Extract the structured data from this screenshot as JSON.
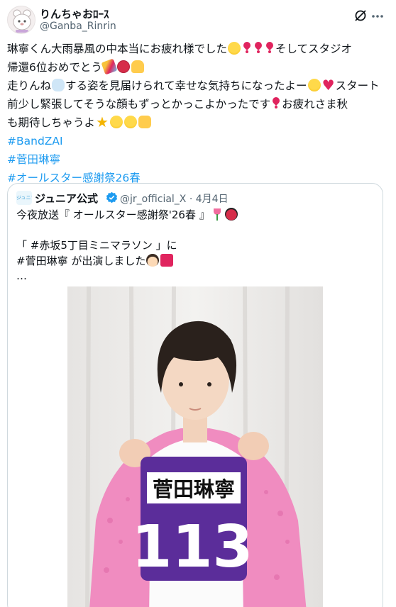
{
  "tweet": {
    "display_name": "りんちゃおﾛｰｽ",
    "handle": "@Ganba_Rinrin",
    "line1": "琳寧くん大雨暴風の中本当にお疲れ様でした",
    "line1b": "そしてスタジオ",
    "line2": "帰還6位おめでとう",
    "line3a": "走りんね",
    "line3b": "する姿を見届けられて幸せな気持ちになったよー",
    "line3c": "スタート",
    "line4a": "前少し緊張してそうな顔もずっとかっこよかったです",
    "line4b": "お疲れさま秋",
    "line5": "も期待しちゃうよ",
    "hashtags": [
      "#BandZAI",
      "#菅田琳寧",
      "#オールスター感謝祭26春"
    ]
  },
  "quote": {
    "avatar_text": "ジュニア",
    "name": "ジュニア公式",
    "handle": "@jr_official_X",
    "separator": "·",
    "date": "4月4日",
    "line1": "今夜放送『 オールスター感謝祭'26春 』",
    "line2": "",
    "line3": "「 #赤坂5丁目ミニマラソン 」に",
    "line4a": "#菅田琳寧",
    "line4b": " が出演しました",
    "line5": "…",
    "photo_bib_name": "菅田琳寧",
    "photo_bib_number": "113"
  },
  "colors": {
    "link": "#1d9bf0",
    "verified": "#1d9bf0",
    "jacket": "#f08cc0",
    "bib": "#5b2d9a"
  },
  "icons": {
    "grok": "grok-icon",
    "more": "more-icon",
    "verified": "verified-badge-icon"
  }
}
